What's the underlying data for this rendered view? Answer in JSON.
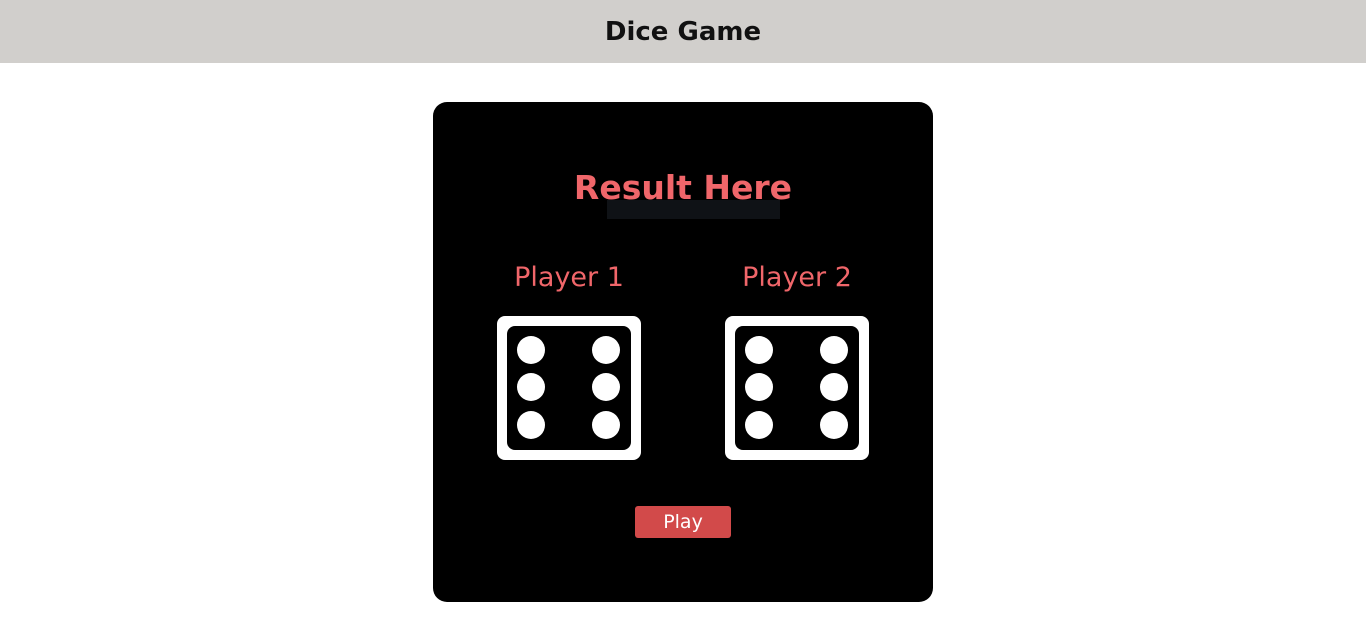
{
  "header": {
    "title": "Dice Game"
  },
  "game": {
    "result_text": "Result Here",
    "players": [
      {
        "label": "Player 1",
        "die_value": 6
      },
      {
        "label": "Player 2",
        "die_value": 6
      }
    ],
    "play_label": "Play"
  },
  "colors": {
    "header_bg": "#d1cfcc",
    "card_bg": "#000000",
    "accent_text": "#f0666a",
    "play_button_bg": "#d24a4a",
    "die_white": "#ffffff"
  }
}
